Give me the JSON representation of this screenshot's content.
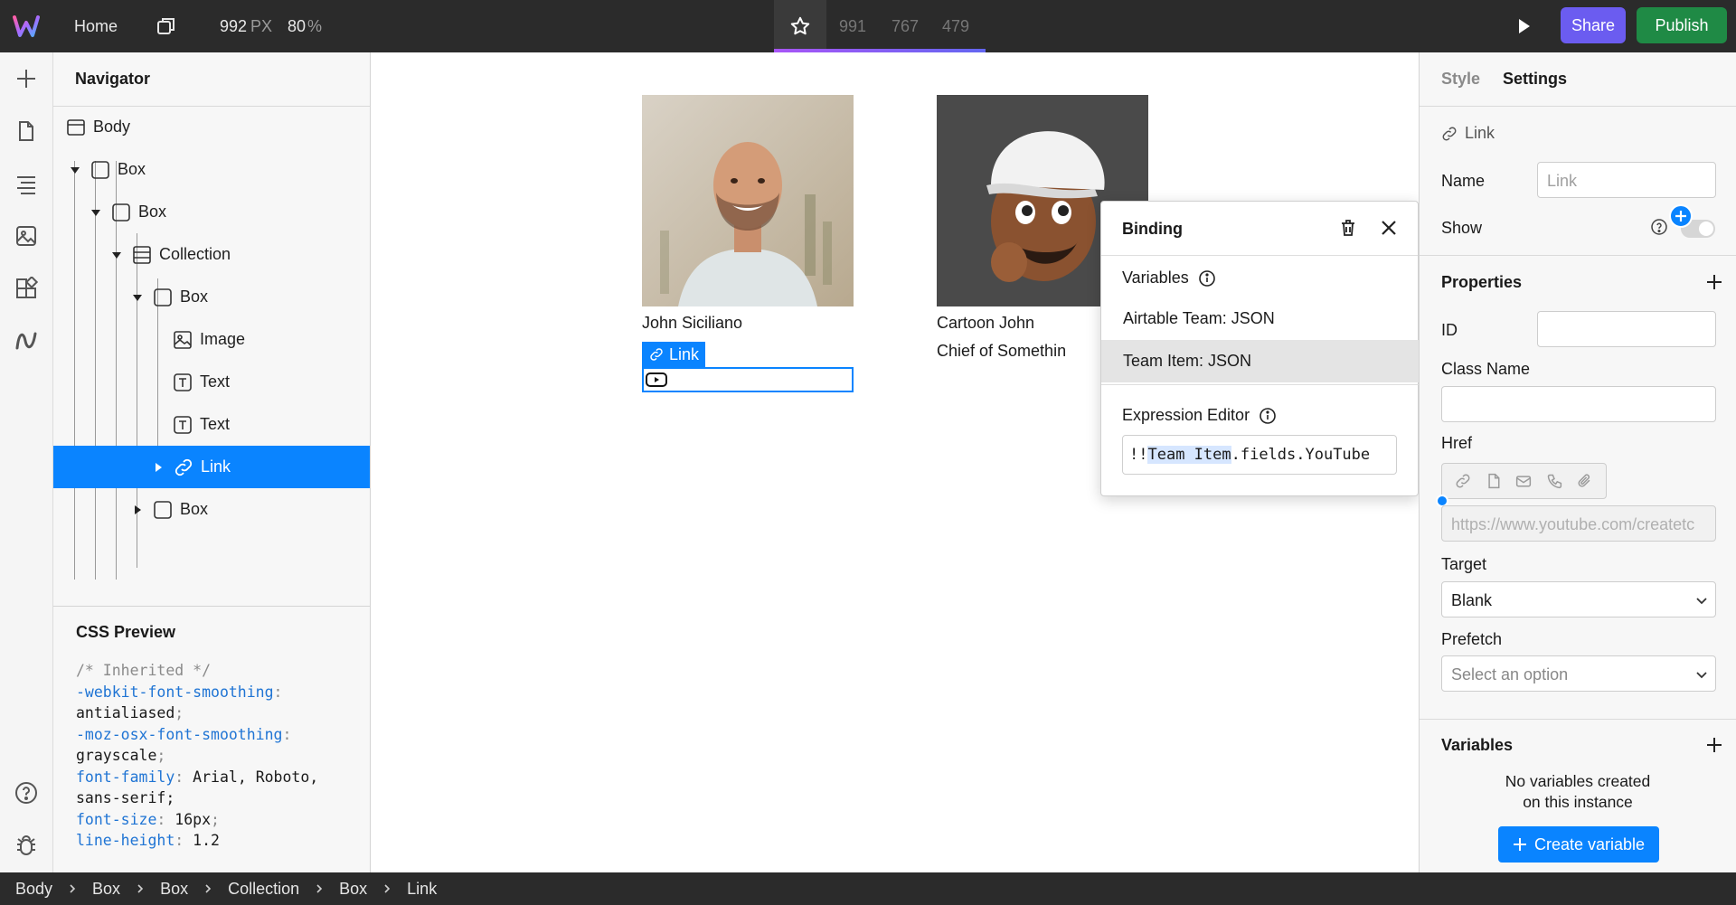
{
  "topbar": {
    "home_label": "Home",
    "canvas_width": "992",
    "width_unit": "PX",
    "zoom": "80",
    "zoom_unit": "%",
    "breakpoints": [
      "991",
      "767",
      "479"
    ],
    "share_label": "Share",
    "publish_label": "Publish",
    "colors": {
      "share": "#6b5cf0",
      "publish": "#1f8a45",
      "breakpoint_bar": "#7c5cf4"
    }
  },
  "rail": {
    "icons": [
      "plus-icon",
      "page-icon",
      "navigator-icon",
      "assets-icon",
      "components-icon",
      "logic-icon",
      "help-icon",
      "bug-icon"
    ]
  },
  "navigator": {
    "title": "Navigator",
    "items": [
      {
        "label": "Body",
        "icon": "body-icon"
      },
      {
        "label": "Box",
        "icon": "box-icon"
      },
      {
        "label": "Box",
        "icon": "box-icon"
      },
      {
        "label": "Collection",
        "icon": "collection-icon"
      },
      {
        "label": "Box",
        "icon": "box-icon"
      },
      {
        "label": "Image",
        "icon": "image-icon"
      },
      {
        "label": "Text",
        "icon": "text-icon"
      },
      {
        "label": "Text",
        "icon": "text-icon"
      },
      {
        "label": "Link",
        "icon": "link-icon"
      },
      {
        "label": "Box",
        "icon": "box-icon"
      }
    ],
    "css_preview": {
      "title": "CSS Preview",
      "comment": "/* Inherited */",
      "rules": [
        {
          "prop": "-webkit-font-smoothing",
          "value": "antialiased"
        },
        {
          "prop": "-moz-osx-font-smoothing",
          "value": "grayscale"
        },
        {
          "prop": "font-family",
          "value": "Arial, Roboto, sans-serif"
        },
        {
          "prop": "font-size",
          "value": "16px"
        },
        {
          "prop": "line-height",
          "value": "1.2"
        }
      ]
    }
  },
  "canvas": {
    "cards": [
      {
        "name": "John Siciliano",
        "subtitle": ""
      },
      {
        "name": "Cartoon John",
        "subtitle": "Chief of Somethin"
      }
    ],
    "link_tag_label": "Link"
  },
  "binding": {
    "title": "Binding",
    "variables_label": "Variables",
    "variables": [
      "Airtable Team: JSON",
      "Team Item: JSON"
    ],
    "expression_label": "Expression Editor",
    "expression_prefix": "!!",
    "expression_highlight": "Team Item",
    "expression_suffix": ".fields.YouTube"
  },
  "settings": {
    "tabs": [
      "Style",
      "Settings"
    ],
    "active_tab": "Settings",
    "element_label": "Link",
    "name_label": "Name",
    "name_placeholder": "Link",
    "show_label": "Show",
    "properties_title": "Properties",
    "id_label": "ID",
    "id_value": "",
    "class_label": "Class Name",
    "class_value": "",
    "href_label": "Href",
    "href_placeholder": "https://www.youtube.com/createtc",
    "target_label": "Target",
    "target_value": "Blank",
    "prefetch_label": "Prefetch",
    "prefetch_placeholder": "Select an option",
    "variables_title": "Variables",
    "no_vars_line1": "No variables created",
    "no_vars_line2": "on this instance",
    "create_variable_label": "Create variable"
  },
  "breadcrumbs": [
    "Body",
    "Box",
    "Box",
    "Collection",
    "Box",
    "Link"
  ]
}
